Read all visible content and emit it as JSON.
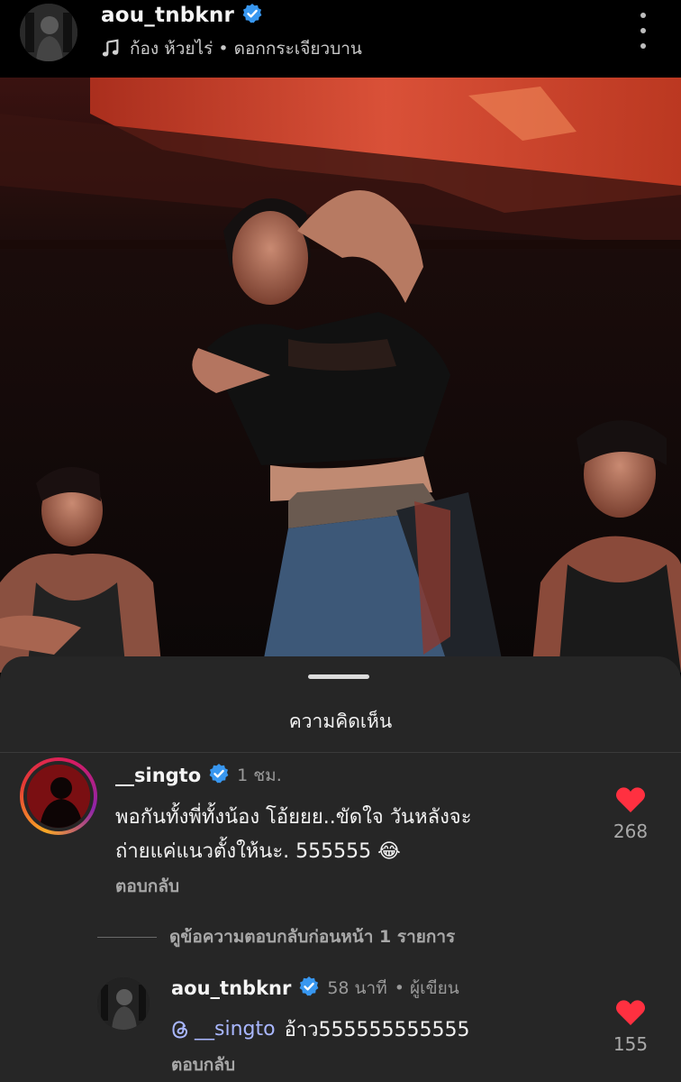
{
  "header": {
    "username": "aou_tnbknr",
    "music": "ก้อง ห้วยไร่ • ดอกกระเจียวบาน",
    "icons": [
      "avatar",
      "verified-badge-icon",
      "music-note-icon",
      "more-options-icon"
    ]
  },
  "photo": {
    "icon": "concert-photo"
  },
  "sheet": {
    "title": "ความคิดเห็น"
  },
  "comments": [
    {
      "username": "__singto",
      "time": "1 ชม.",
      "text_line1": "พอกันทั้งพี่ทั้งน้อง โอ้ยยย..ขัดใจ วันหลังจะ",
      "text_line2": "ถ่ายแค่แนวตั้งให้นะ. 555555 😂",
      "reply_label": "ตอบกลับ",
      "likes": "268"
    }
  ],
  "view_previous": "ดูข้อความตอบกลับก่อนหน้า 1 รายการ",
  "replies": [
    {
      "username": "aou_tnbknr",
      "time": "58 นาที",
      "author_label": "• ผู้เขียน",
      "mention": "__singto",
      "text": "อ้าว555555555555",
      "reply_label": "ตอบกลับ",
      "likes": "155"
    }
  ],
  "colors": {
    "like_red": "#ff3040",
    "verified_blue": "#3897f0",
    "mention": "#a9b7ff",
    "sheet_bg": "#262626"
  }
}
